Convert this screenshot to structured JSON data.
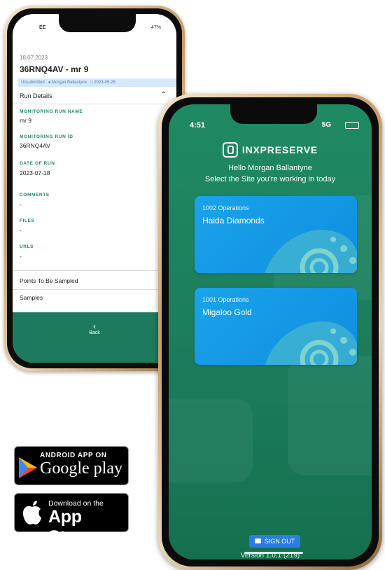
{
  "back_phone": {
    "status": {
      "carrier": "EE",
      "battery": "47%"
    },
    "date": "18.07.2023",
    "title": "36RNQ4AV - mr 9",
    "meta": {
      "status": "Unsubmitted",
      "user": "Morgan Ballantyne",
      "date": "2023-05-25"
    },
    "section": "Run Details",
    "fields": [
      {
        "label": "MONITORING RUN NAME",
        "value": "mr 9"
      },
      {
        "label": "MONITORING RUN ID",
        "value": "36RNQ4AV"
      },
      {
        "label": "DATE OF RUN",
        "value": "2023-07-18"
      },
      {
        "label": "COMMENTS",
        "value": "-"
      },
      {
        "label": "FILES",
        "value": "-"
      },
      {
        "label": "URLS",
        "value": "-"
      }
    ],
    "links": [
      "Points To Be Sampled",
      "Samples"
    ],
    "back_label": "Back"
  },
  "front_phone": {
    "status": {
      "time": "4:51",
      "network": "5G"
    },
    "brand": {
      "prefix": "INX",
      "name": "PRESERVE"
    },
    "greeting": "Hello Morgan Ballantyne",
    "subtitle": "Select the Site you're working in today",
    "sites": [
      {
        "ops": "1002 Operations",
        "name": "Haida Diamonds"
      },
      {
        "ops": "1001 Operations",
        "name": "Migaloo Gold"
      }
    ],
    "sign_out": "SIGN OUT",
    "version": "Version 1.0.1 (219)"
  },
  "stores": {
    "google": {
      "top": "ANDROID APP ON",
      "bottom": "Google play"
    },
    "apple": {
      "top": "Download on the",
      "bottom": "App Store"
    }
  },
  "colors": {
    "app_green": "#1f8a62",
    "card_blue": "#1aa3ea",
    "accent_blue": "#2a7de1",
    "field_label_green": "#1f8a5c"
  }
}
